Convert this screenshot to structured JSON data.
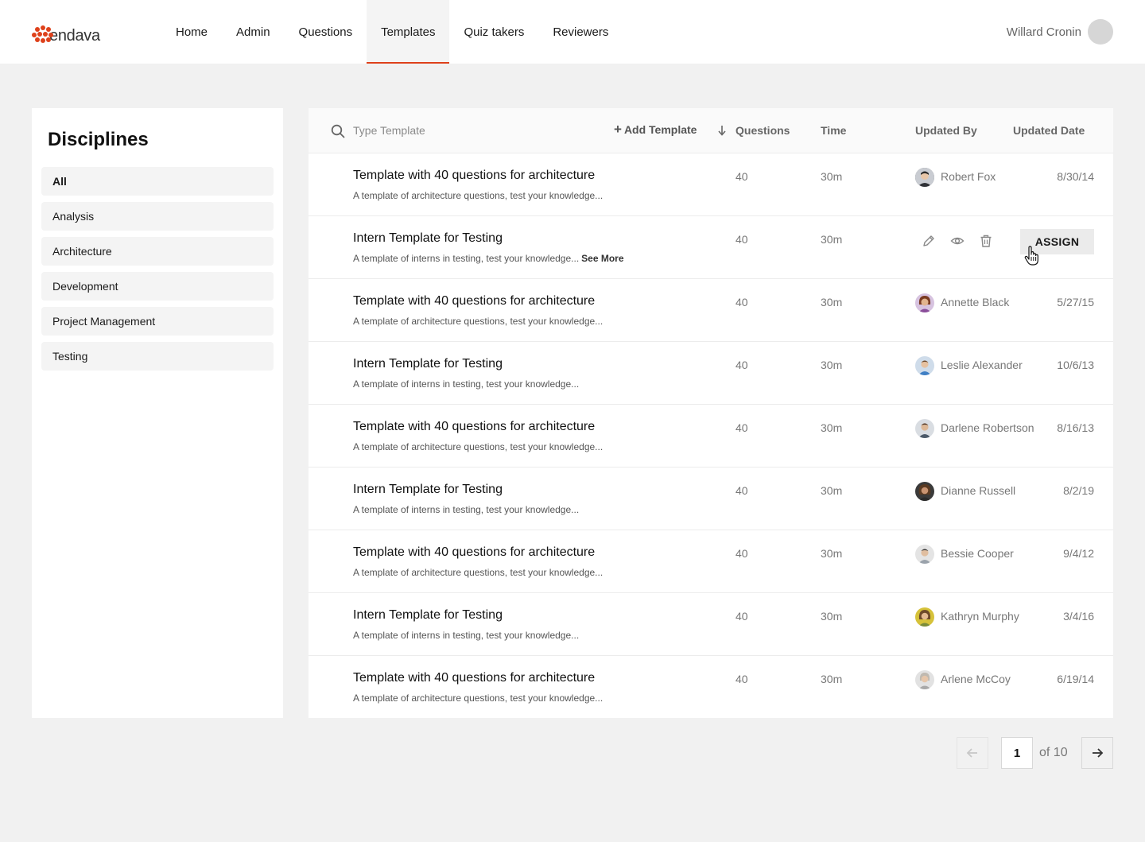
{
  "brand": {
    "logo_text": "endava",
    "accent": "#de411b"
  },
  "nav": {
    "items": [
      "Home",
      "Admin",
      "Questions",
      "Templates",
      "Quiz takers",
      "Reviewers"
    ],
    "active": "Templates"
  },
  "user": {
    "name": "Willard Cronin"
  },
  "sidebar": {
    "title": "Disciplines",
    "items": [
      "All",
      "Analysis",
      "Architecture",
      "Development",
      "Project Management",
      "Testing"
    ],
    "active": "All"
  },
  "table": {
    "search_placeholder": "Type Template",
    "add_label": "Add Template",
    "headers": {
      "questions": "Questions",
      "time": "Time",
      "updated_by": "Updated By",
      "updated_date": "Updated Date"
    },
    "rows": [
      {
        "title": "Template with 40 questions for architecture",
        "description": "A template of architecture questions, test your knowledge...",
        "questions": "40",
        "time": "30m",
        "updated_by": "Robert Fox",
        "updated_date": "8/30/14"
      },
      {
        "title": "Intern Template for Testing",
        "description": "A template of interns in testing, test your knowledge...",
        "see_more": "See More",
        "questions": "40",
        "time": "30m",
        "assign_label": "ASSIGN",
        "hovered": true
      },
      {
        "title": "Template with 40 questions for architecture",
        "description": "A template of architecture questions, test your knowledge...",
        "questions": "40",
        "time": "30m",
        "updated_by": "Annette Black",
        "updated_date": "5/27/15"
      },
      {
        "title": "Intern Template for Testing",
        "description": "A template of interns in testing, test your knowledge...",
        "questions": "40",
        "time": "30m",
        "updated_by": "Leslie Alexander",
        "updated_date": "10/6/13"
      },
      {
        "title": "Template with 40 questions for architecture",
        "description": "A template of architecture questions, test your knowledge...",
        "questions": "40",
        "time": "30m",
        "updated_by": "Darlene Robertson",
        "updated_date": "8/16/13"
      },
      {
        "title": "Intern Template for Testing",
        "description": "A template of interns in testing, test your knowledge...",
        "questions": "40",
        "time": "30m",
        "updated_by": "Dianne Russell",
        "updated_date": "8/2/19"
      },
      {
        "title": "Template with 40 questions for architecture",
        "description": "A template of architecture questions, test your knowledge...",
        "questions": "40",
        "time": "30m",
        "updated_by": "Bessie Cooper",
        "updated_date": "9/4/12"
      },
      {
        "title": "Intern Template for Testing",
        "description": "A template of interns in testing, test your knowledge...",
        "questions": "40",
        "time": "30m",
        "updated_by": "Kathryn Murphy",
        "updated_date": "3/4/16"
      },
      {
        "title": "Template with 40 questions for architecture",
        "description": "A template of architecture questions, test your knowledge...",
        "questions": "40",
        "time": "30m",
        "updated_by": "Arlene McCoy",
        "updated_date": "6/19/14"
      }
    ]
  },
  "pagination": {
    "current": "1",
    "of_label": "of 10"
  }
}
